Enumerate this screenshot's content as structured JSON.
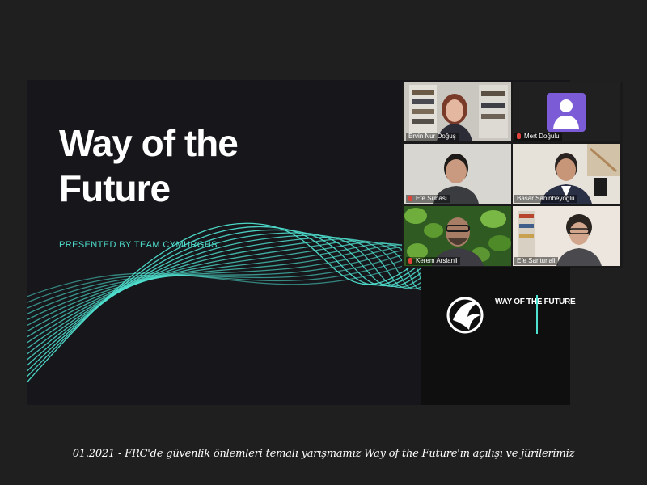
{
  "slide": {
    "title": "Way of the\nFuture",
    "subtitle": "PRESENTED BY TEAM CYMURGHS",
    "accent_color": "#4fe0cf"
  },
  "participants": [
    {
      "name": "Ervin Nur Doğuş",
      "video": true,
      "active_speaker": true,
      "muted": false
    },
    {
      "name": "Mert Doğulu",
      "video": false,
      "muted": true,
      "avatar_icon": "person-icon"
    },
    {
      "name": "Efe Subasi",
      "video": true,
      "muted": true
    },
    {
      "name": "Basar Sahinbeyoglu",
      "video": true,
      "muted": false
    },
    {
      "name": "Kerem Arslanli",
      "video": true,
      "muted": true
    },
    {
      "name": "Efe Saritunali",
      "video": true,
      "muted": false
    }
  ],
  "logos": {
    "team_logo_icon": "phoenix-logo-icon",
    "event_logo_text": "WAY OF THE FUTURE"
  },
  "caption": "01.2021 - FRC'de güvenlik önlemleri temalı yarışmamız Way of the Future'ın açılışı ve jürilerimiz"
}
